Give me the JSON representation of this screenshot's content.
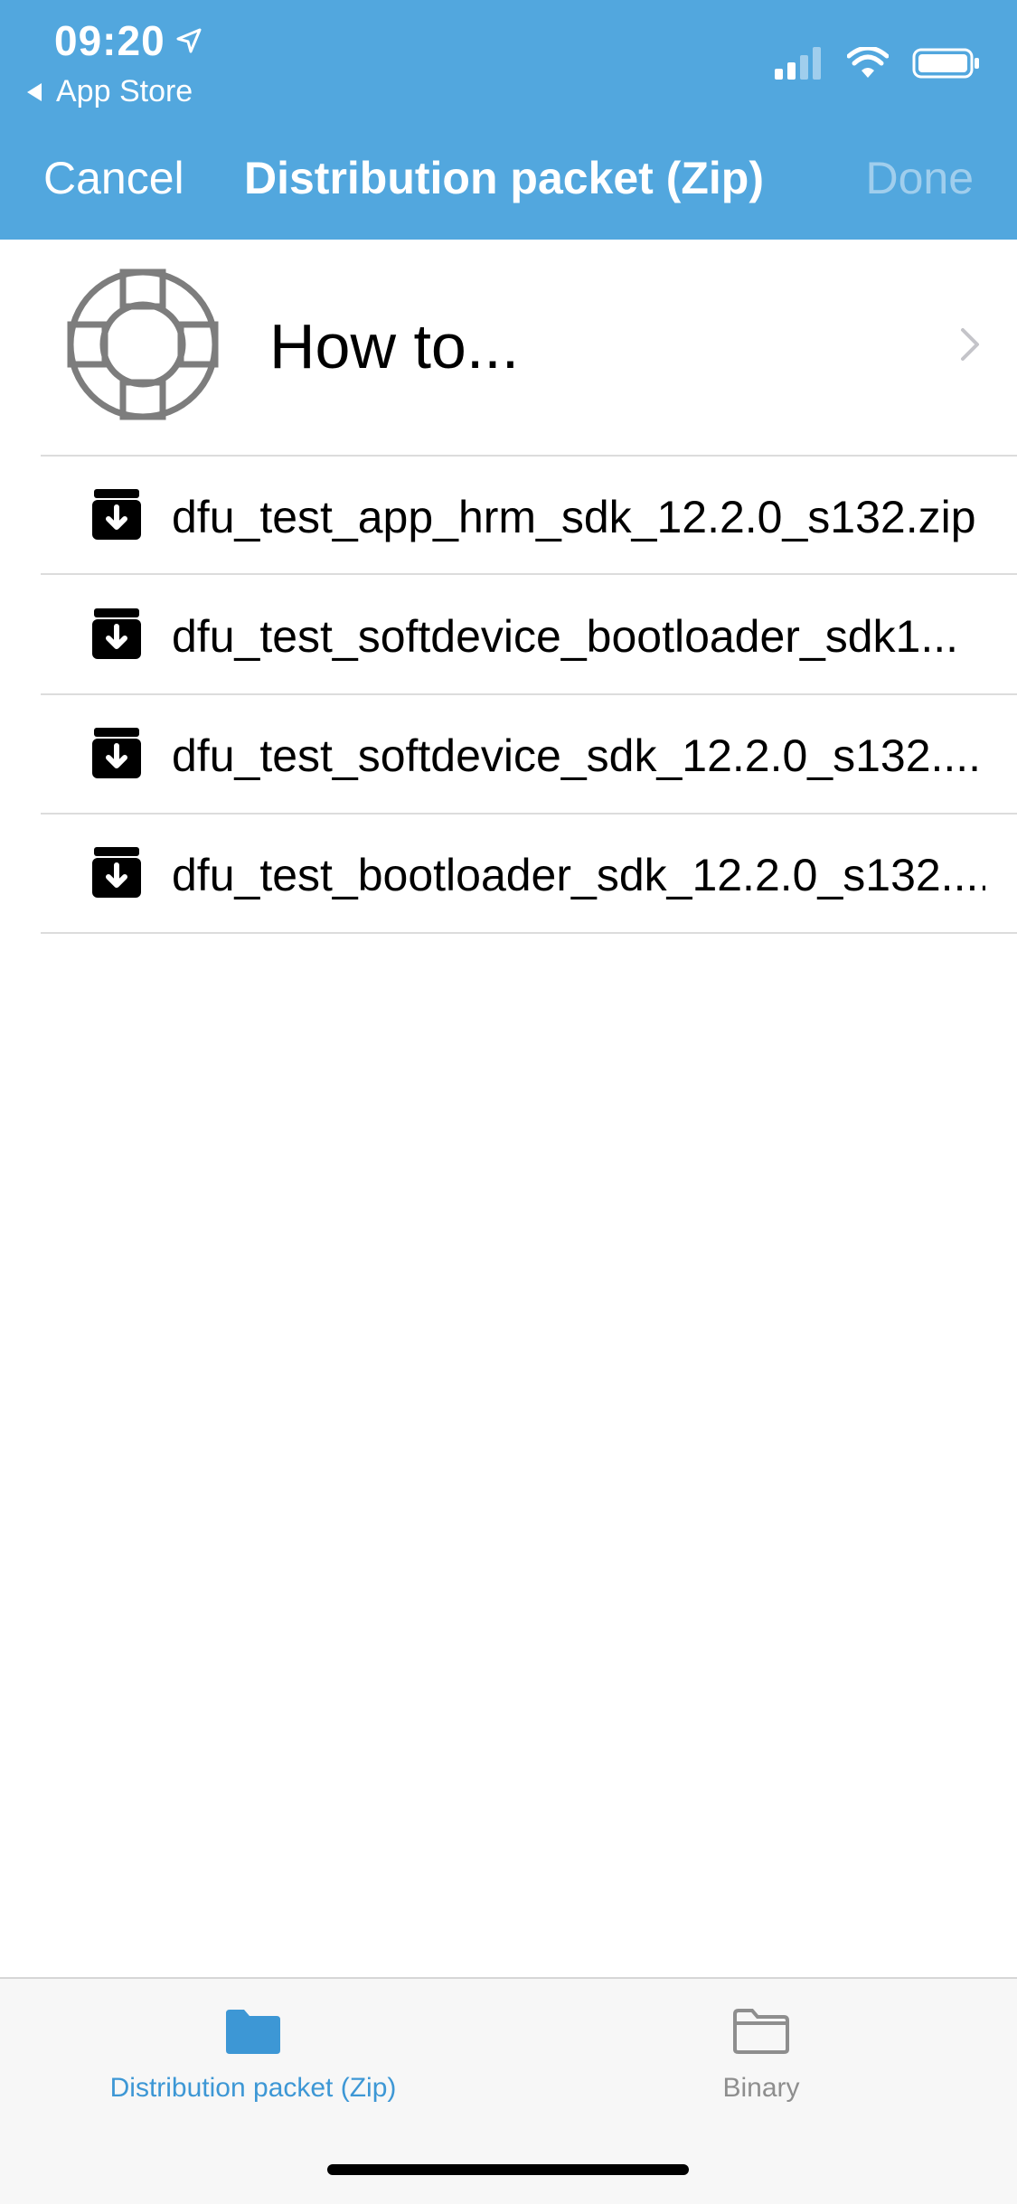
{
  "status_bar": {
    "time": "09:20",
    "back_app": "App Store"
  },
  "nav": {
    "cancel_label": "Cancel",
    "title": "Distribution packet (Zip)",
    "done_label": "Done"
  },
  "howto": {
    "label": "How to...",
    "icon": "lifebuoy-icon"
  },
  "files": [
    {
      "name": "dfu_test_app_hrm_sdk_12.2.0_s132.zip",
      "icon": "archive-icon"
    },
    {
      "name": "dfu_test_softdevice_bootloader_sdk1...",
      "icon": "archive-icon"
    },
    {
      "name": "dfu_test_softdevice_sdk_12.2.0_s132....",
      "icon": "archive-icon"
    },
    {
      "name": "dfu_test_bootloader_sdk_12.2.0_s132....",
      "icon": "archive-icon"
    }
  ],
  "tabs": [
    {
      "label": "Distribution packet (Zip)",
      "icon": "folder-filled-icon",
      "selected": true
    },
    {
      "label": "Binary",
      "icon": "folder-outline-icon",
      "selected": false
    }
  ],
  "colors": {
    "header_bg": "#52a7de",
    "tab_active": "#3d97d5",
    "tab_inactive": "#8e8e8e"
  }
}
